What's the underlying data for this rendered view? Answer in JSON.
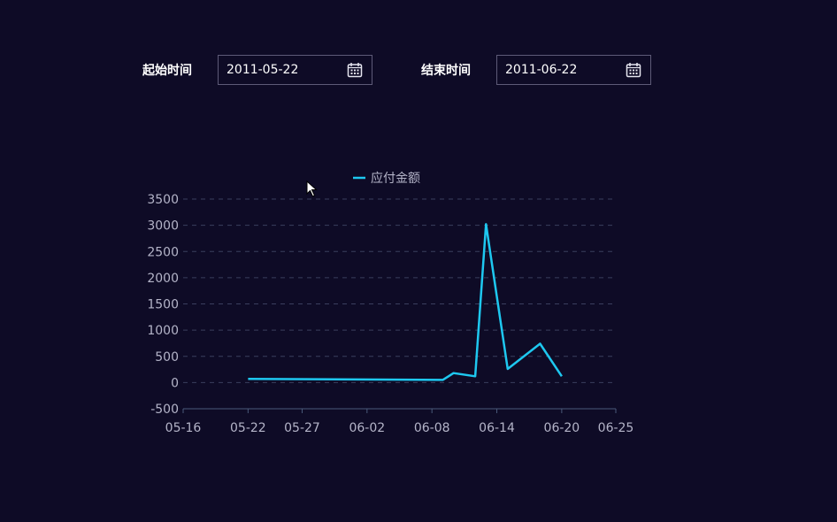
{
  "filters": {
    "start_label": "起始时间",
    "start_value": "2011-05-22",
    "end_label": "结束时间",
    "end_value": "2011-06-22",
    "calendar_icon": "calendar-icon"
  },
  "colors": {
    "background": "#0e0b26",
    "line": "#1ec8f0",
    "axis_text": "#b4b4c8",
    "grid": "#3a3f5e"
  },
  "chart_data": {
    "type": "line",
    "legend": "应付金额",
    "legend_position": "top-center",
    "grid": true,
    "ylim": [
      -500,
      3500
    ],
    "yticks": [
      "3500",
      "3000",
      "2500",
      "2000",
      "1500",
      "1000",
      "500",
      "0",
      "-500"
    ],
    "xlim": [
      "2011-05-16",
      "2011-06-25"
    ],
    "xticks": [
      "05-16",
      "05-22",
      "05-27",
      "06-02",
      "06-08",
      "06-14",
      "06-20",
      "06-25"
    ],
    "series": [
      {
        "name": "应付金额",
        "x": [
          "2011-05-22",
          "2011-06-09",
          "2011-06-10",
          "2011-06-12",
          "2011-06-13",
          "2011-06-15",
          "2011-06-18",
          "2011-06-20"
        ],
        "values": [
          70,
          50,
          180,
          120,
          3020,
          260,
          740,
          120
        ]
      }
    ]
  }
}
